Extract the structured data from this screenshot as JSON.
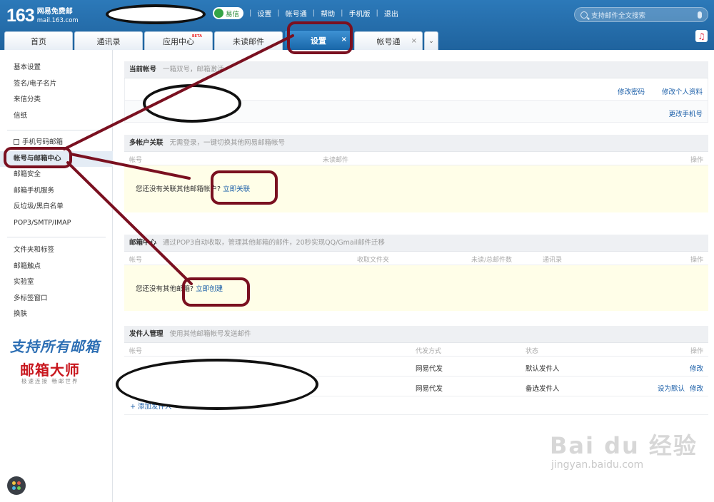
{
  "header": {
    "logo_number": "163",
    "logo_title": "网易免费邮",
    "logo_domain": "mail.163.com",
    "yixin_label": "易信",
    "nav_links": [
      "设置",
      "帐号通",
      "帮助",
      "手机版",
      "退出"
    ],
    "search_placeholder": "支持邮件全文搜索",
    "colors": {
      "brand_blue": "#1f639e",
      "yixin_green": "#35a447"
    }
  },
  "tabs": [
    {
      "label": "首页"
    },
    {
      "label": "通讯录"
    },
    {
      "label": "应用中心",
      "badge": "BETA"
    },
    {
      "label": "未读邮件"
    },
    {
      "label": "设置",
      "closable": "×",
      "active": true
    },
    {
      "label": "帐号通",
      "closable": "×"
    }
  ],
  "tab_more": "⌄",
  "sidebar": {
    "group1": [
      "基本设置",
      "签名/电子名片",
      "来信分类",
      "信纸"
    ],
    "group2": [
      "手机号码邮箱",
      "帐号与邮箱中心",
      "邮箱安全",
      "邮箱手机服务",
      "反垃圾/黑白名单",
      "POP3/SMTP/IMAP"
    ],
    "group3": [
      "文件夹和标签",
      "邮箱触点",
      "实验室",
      "多标签窗口",
      "换肤"
    ],
    "brand_slogan": "支持所有邮箱",
    "brand_name": "邮箱大师",
    "brand_sub": "极速连接 畅邮世界"
  },
  "current_account": {
    "title": "当前帐号",
    "desc": "一箱双号，邮箱激活",
    "edit_password": "修改密码",
    "edit_profile": "修改个人资料",
    "change_phone": "更改手机号"
  },
  "multi_account": {
    "title": "多帐户关联",
    "desc": "无需登录，一键切换其他网易邮箱帐号",
    "col_account": "帐号",
    "col_unread": "未读邮件",
    "col_action": "操作",
    "empty_msg": "您还没有关联其他邮箱帐户?",
    "link_now": "立即关联"
  },
  "mailbox_center": {
    "title": "邮箱中心",
    "desc": "通过POP3自动收取，管理其他邮箱的邮件，20秒实现QQ/Gmail邮件迁移",
    "col_account": "帐号",
    "col_folder": "收取文件夹",
    "col_count": "未读/总邮件数",
    "col_contacts": "通讯录",
    "col_action": "操作",
    "empty_msg": "您还没有其他邮箱?",
    "create_now": "立即创建"
  },
  "sender_mgmt": {
    "title": "发件人管理",
    "desc": "使用其他邮箱帐号发送邮件",
    "col_account": "帐号",
    "col_method": "代发方式",
    "col_status": "状态",
    "col_action": "操作",
    "rows": [
      {
        "method": "网易代发",
        "status": "默认发件人",
        "actions": [
          "修改"
        ]
      },
      {
        "method": "网易代发",
        "status": "备选发件人",
        "actions": [
          "设为默认",
          "修改"
        ]
      }
    ],
    "add_sender": "+ 添加发件人"
  },
  "watermark": {
    "line1": "Bai du 经验",
    "line2": "jingyan.baidu.com"
  }
}
